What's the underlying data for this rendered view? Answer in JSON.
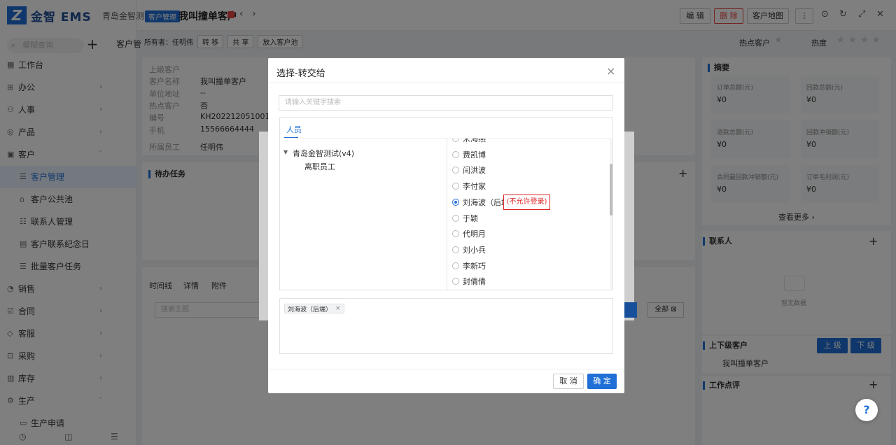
{
  "app": {
    "logo_mark": "Z",
    "logo_text": "金智 EMS"
  },
  "sidebar": {
    "search_placeholder": "模糊查询",
    "plus": "+",
    "items": [
      {
        "icon": "▦",
        "label": "工作台",
        "chevron": ""
      },
      {
        "icon": "⊞",
        "label": "办公",
        "chevron": "›"
      },
      {
        "icon": "⚇",
        "label": "人事",
        "chevron": "›"
      },
      {
        "icon": "◎",
        "label": "产品",
        "chevron": "›"
      },
      {
        "icon": "▣",
        "label": "客户",
        "chevron": "˅"
      },
      {
        "icon": "☰",
        "label": "客户管理",
        "chevron": ""
      },
      {
        "icon": "⌂",
        "label": "客户公共池",
        "chevron": ""
      },
      {
        "icon": "☷",
        "label": "联系人管理",
        "chevron": ""
      },
      {
        "icon": "▤",
        "label": "客户联系纪念日",
        "chevron": ""
      },
      {
        "icon": "☰",
        "label": "批量客户任务",
        "chevron": ""
      },
      {
        "icon": "◔",
        "label": "销售",
        "chevron": "›"
      },
      {
        "icon": "☑",
        "label": "合同",
        "chevron": "›"
      },
      {
        "icon": "◇",
        "label": "客服",
        "chevron": "›"
      },
      {
        "icon": "⊡",
        "label": "采购",
        "chevron": "›"
      },
      {
        "icon": "▥",
        "label": "库存",
        "chevron": "›"
      },
      {
        "icon": "⚙",
        "label": "生产",
        "chevron": "˅"
      },
      {
        "icon": "▭",
        "label": "生产申请",
        "chevron": ""
      }
    ],
    "bottom_icons": [
      "◷",
      "◫",
      "☰"
    ]
  },
  "topbar": {
    "company": "青岛金智测",
    "tag": "客户管理",
    "title": "我叫撞单客户",
    "prev": "‹",
    "next": "›",
    "edit": "编 辑",
    "delete": "删 除",
    "map": "客户地图",
    "more": "⋮",
    "icons": [
      "⊙",
      "↻",
      "⤢",
      "✕"
    ]
  },
  "main": {
    "customer_label": "客户管",
    "owner_prefix": "所有者：任明伟",
    "transfer": "转 移",
    "share": "共 享",
    "to_pool": "放入客户池",
    "info": [
      {
        "label": "上级客户",
        "value": ""
      },
      {
        "label": "客户名称",
        "value": "我叫撞单客户"
      },
      {
        "label": "单位地址",
        "value": "--"
      },
      {
        "label": "热点客户",
        "value": "否"
      },
      {
        "label": "编号",
        "value": "KH202212051001"
      },
      {
        "label": "手机",
        "value": "15566664444"
      },
      {
        "label": "所属员工",
        "value": "任明伟"
      }
    ],
    "todo_title": "待办任务",
    "todo_plus": "+",
    "tabs": [
      "时间线",
      "详情",
      "附件"
    ],
    "timeline_search": "搜索主题",
    "all": "全部 ⊠"
  },
  "right": {
    "hot": "热点客户",
    "heat": "热度",
    "summary_title": "摘要",
    "metrics": [
      {
        "label": "订单总额(元)",
        "value": "¥0"
      },
      {
        "label": "回款总额(元)",
        "value": "¥0"
      },
      {
        "label": "退款总额(元)",
        "value": "¥0"
      },
      {
        "label": "回款冲销额(元)",
        "value": "¥0"
      },
      {
        "label": "合同最回款冲销额(元)",
        "value": "¥0"
      },
      {
        "label": "订单毛利润(元)",
        "value": "¥0"
      }
    ],
    "view_more": "查看更多 ›",
    "contact_title": "联系人",
    "contact_plus": "+",
    "no_data": "暂无数据",
    "hier_title": "上下级客户",
    "upper": "上 级",
    "lower": "下 级",
    "hier_child": "我叫撞单客户",
    "review_title": "工作点评",
    "review_plus": "+",
    "help": "?"
  },
  "dialog": {
    "title": "选择-转交给",
    "close": "×",
    "search_placeholder": "请输入关键字搜索",
    "tab": "人员",
    "tree_caret": "▼",
    "org": "青岛金智测试(v4)",
    "org_child": "离职员工",
    "people": [
      {
        "name": "宋海燕",
        "checked": false
      },
      {
        "name": "费凯博",
        "checked": false
      },
      {
        "name": "闫洪波",
        "checked": false
      },
      {
        "name": "李付家",
        "checked": false
      },
      {
        "name": "刘海波（后端",
        "checked": true
      },
      {
        "name": "于颖",
        "checked": false
      },
      {
        "name": "代明月",
        "checked": false
      },
      {
        "name": "刘小兵",
        "checked": false
      },
      {
        "name": "李新巧",
        "checked": false
      },
      {
        "name": "封倩倩",
        "checked": false
      }
    ],
    "warning": "(不允许登录)",
    "selected_chip": "刘海波（后端）",
    "chip_remove": "×",
    "cancel": "取 消",
    "confirm": "确 定"
  },
  "colors": {
    "primary": "#1f6fd6",
    "danger": "#e02424"
  }
}
